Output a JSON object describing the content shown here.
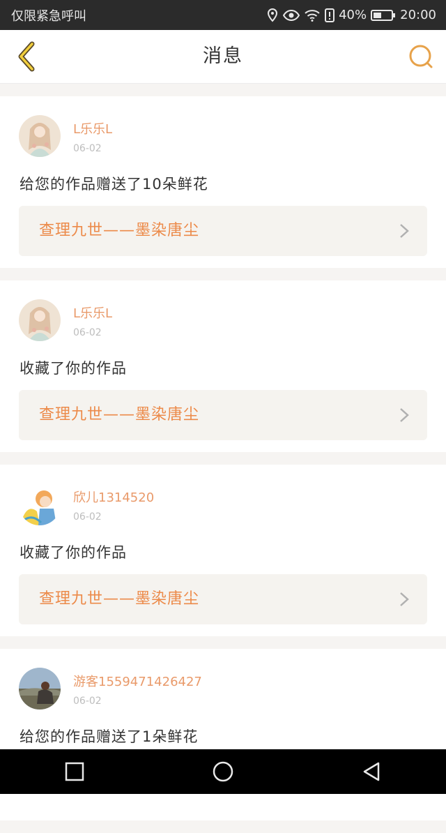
{
  "status_bar": {
    "carrier": "仅限紧急呼叫",
    "battery": "40%",
    "time": "20:00"
  },
  "header": {
    "title": "消息",
    "back_icon": "chevron-left-icon",
    "search_icon": "search-icon",
    "accent_color": "#e7a24a"
  },
  "messages": [
    {
      "username": "L乐乐L",
      "date": "06-02",
      "text": "给您的作品赠送了10朵鲜花",
      "work": "查理九世——墨染唐尘",
      "avatar": "illustrated-girl-avatar"
    },
    {
      "username": "L乐乐L",
      "date": "06-02",
      "text": "收藏了你的作品",
      "work": "查理九世——墨染唐尘",
      "avatar": "illustrated-girl-avatar"
    },
    {
      "username": "欣儿1314520",
      "date": "06-02",
      "text": "收藏了你的作品",
      "work": "查理九世——墨染唐尘",
      "avatar": "anime-girl-avatar"
    },
    {
      "username": "游客1559471426427",
      "date": "06-02",
      "text": "给您的作品赠送了1朵鲜花",
      "work": "",
      "avatar": "landscape-photo-avatar"
    }
  ],
  "colors": {
    "username": "#e99a6a",
    "work_title": "#ec8a49",
    "link_background": "#f5f3ef"
  }
}
